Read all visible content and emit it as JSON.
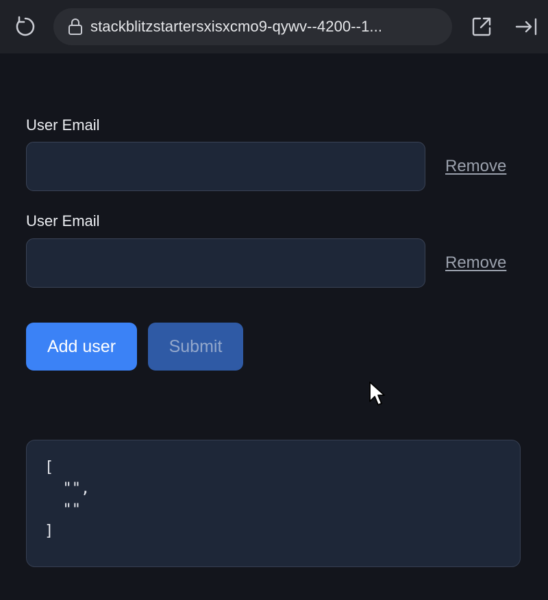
{
  "browser": {
    "url": "stackblitzstartersxisxcmo9-qywv--4200--1...",
    "icons": {
      "reload": "reload-icon",
      "lock": "lock-icon",
      "open_new_tab": "open-in-new-tab-icon",
      "collapse": "collapse-panel-icon"
    }
  },
  "form": {
    "users": [
      {
        "label": "User Email",
        "value": "",
        "placeholder": "",
        "remove_label": "Remove"
      },
      {
        "label": "User Email",
        "value": "",
        "placeholder": "",
        "remove_label": "Remove"
      }
    ],
    "add_user_label": "Add user",
    "submit_label": "Submit"
  },
  "output": {
    "json_text": "[\n  \"\",\n  \"\"\n]"
  },
  "colors": {
    "background": "#13151c",
    "toolbar": "#1f2127",
    "input_bg": "#1e2738",
    "primary": "#3b82f6",
    "primary_disabled": "#2f5aa5",
    "link": "#9ba1ad"
  }
}
